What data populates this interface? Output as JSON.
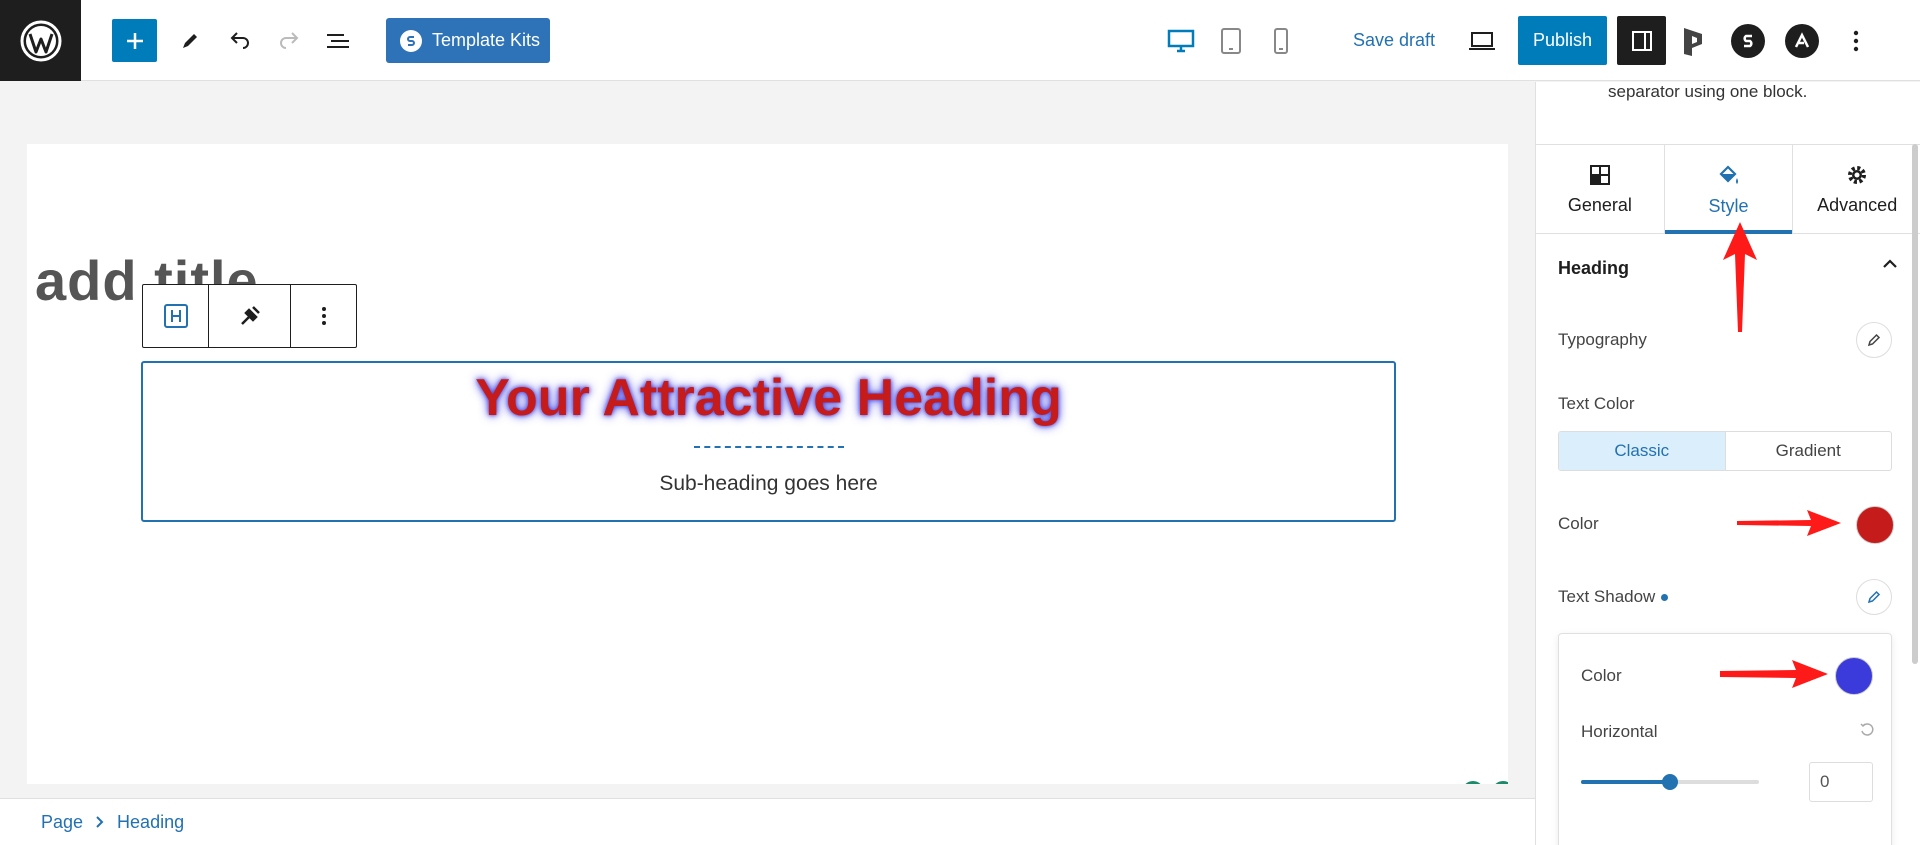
{
  "toolbar": {
    "template_kits_label": "Template Kits",
    "save_draft_label": "Save draft",
    "publish_label": "Publish"
  },
  "canvas": {
    "page_title": "add title",
    "heading": "Your Attractive Heading",
    "separator": "----------------",
    "sub_heading": "Sub-heading goes here"
  },
  "breadcrumb": {
    "items": [
      "Page",
      "Heading"
    ]
  },
  "sidebar": {
    "description": "separator using one block.",
    "tabs": [
      {
        "label": "General"
      },
      {
        "label": "Style"
      },
      {
        "label": "Advanced"
      }
    ],
    "section_title": "Heading",
    "typography_label": "Typography",
    "text_color_label": "Text Color",
    "text_color_modes": [
      "Classic",
      "Gradient"
    ],
    "color_label": "Color",
    "color_value": "#c51b1b",
    "text_shadow_label": "Text Shadow",
    "shadow": {
      "color_label": "Color",
      "color_value": "#3b3bdb",
      "horizontal_label": "Horizontal",
      "horizontal_value": "0",
      "slider_fraction": 0.5
    }
  },
  "colors": {
    "accent": "#007cba",
    "annotation_arrow": "#ff1a1a"
  }
}
